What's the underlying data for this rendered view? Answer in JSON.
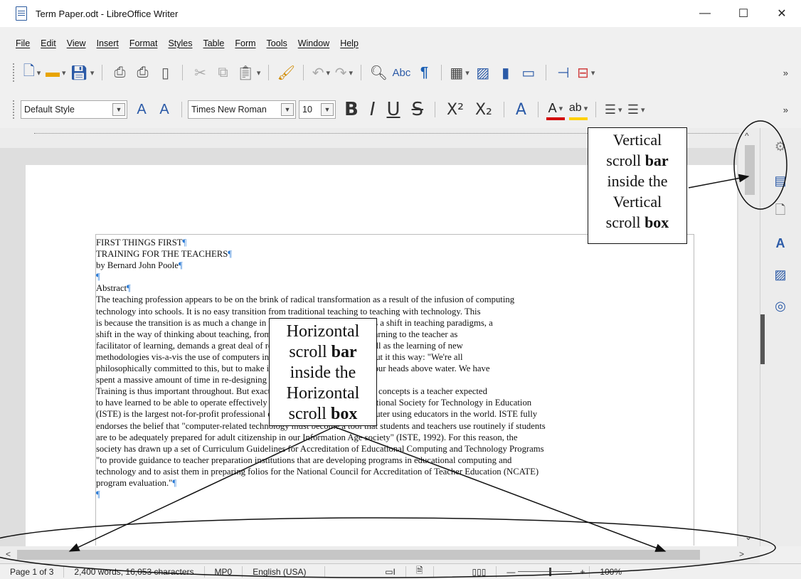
{
  "window": {
    "title": "Term Paper.odt - LibreOffice Writer",
    "minimize": "—",
    "maximize": "☐",
    "close": "✕"
  },
  "menu": [
    "File",
    "Edit",
    "View",
    "Insert",
    "Format",
    "Styles",
    "Table",
    "Form",
    "Tools",
    "Window",
    "Help"
  ],
  "formatting": {
    "paragraph_style": "Default Style",
    "font_name": "Times New Roman",
    "font_size": "10"
  },
  "document": {
    "lines": [
      "FIRST THINGS FIRST",
      "TRAINING FOR THE TEACHERS",
      "by Bernard John Poole",
      "",
      "Abstract",
      "The teaching profession appears to be on the brink of radical transformation as a result of the infusion of computing",
      "technology into schools. It is no easy transition from traditional teaching to teaching with technology. This",
      "is because the transition is as much a change in the methodologies. It involves a shift in teaching paradigms, a",
      "shift in the way of thinking about teaching, from the teacher as imparter of learning to the teacher as",
      "facilitator of learning, demands a great deal of rethinking and re-design as well as the learning of new",
      "methodologies vis-a-vis the use of computers in the classroom. One teacher put it this way: \"We're all",
      "philosophically committed to this, but to make it work, we're barely keeping our heads above water. We have",
      "spent a massive amount of time in re-designing courses.\"",
      "Training is thus important throughout. But exactly what technology skills and concepts is a teacher expected",
      "to have learned to be able to operate effectively in schools today? The International Society for Technology in Education",
      "(ISTE) is the largest not-for-profit professional organization supporting computer using educators in the world. ISTE fully",
      "endorses the belief that \"computer-related technology must become a tool that students and teachers use routinely if students",
      "are to be adequately prepared for adult citizenship in our Information Age society\" (ISTE, 1992). For this reason, the",
      "society has drawn up a set of Curriculum Guidelines for Accreditation of Educational Computing and Technology Programs",
      "\"to provide guidance to teacher preparation institutions that are developing programs in educational computing and",
      "technology and to asist them in preparing folios for the National Council for Accreditation of Teacher Education (NCATE)",
      "program evaluation.\"",
      ""
    ]
  },
  "statusbar": {
    "page": "Page 1 of 3",
    "words": "2,400 words, 16,053 characters",
    "page_style": "MP0",
    "language": "English (USA)",
    "zoom": "100%"
  },
  "annotations": {
    "vertical": [
      "Vertical",
      "scroll bar",
      "inside the",
      "Vertical",
      "scroll box"
    ],
    "horizontal": [
      "Horizontal",
      "scroll bar",
      "inside the",
      "Horizontal",
      "scroll box"
    ]
  },
  "icons": {
    "toolbar1": [
      "new-document-icon",
      "open-icon",
      "save-icon",
      "export-pdf-icon",
      "print-icon",
      "print-preview-icon",
      "cut-icon",
      "copy-icon",
      "paste-icon",
      "clone-formatting-icon",
      "undo-icon",
      "redo-icon",
      "find-replace-icon",
      "spelling-icon",
      "formatting-marks-icon",
      "insert-table-icon",
      "insert-image-icon",
      "insert-chart-icon",
      "insert-textbox-icon",
      "insert-page-break-icon",
      "insert-field-icon"
    ],
    "toolbar2": [
      "update-style-icon",
      "new-style-icon",
      "bold-icon",
      "italic-icon",
      "underline-icon",
      "strikethrough-icon",
      "superscript-icon",
      "subscript-icon",
      "clear-formatting-icon",
      "font-color-icon",
      "highlight-icon",
      "bullets-icon",
      "numbering-icon"
    ],
    "sidebar": [
      "properties-icon",
      "page-icon",
      "styles-icon",
      "gallery-icon",
      "navigator-icon"
    ]
  }
}
